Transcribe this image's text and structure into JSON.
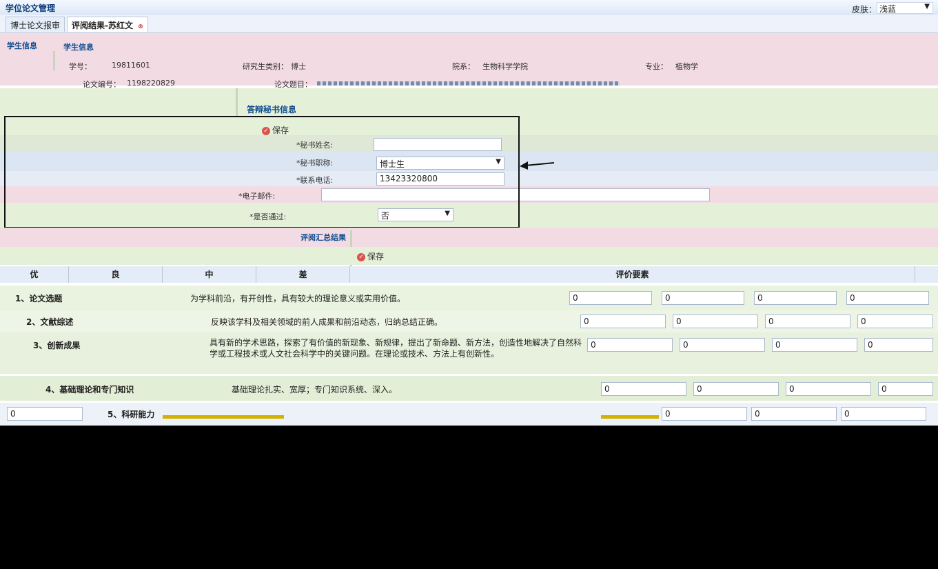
{
  "app": {
    "title": "学位论文管理"
  },
  "skin": {
    "label": "皮肤：",
    "value": "浅蓝"
  },
  "tabs": [
    {
      "label": "博士论文报审"
    },
    {
      "label": "评阅结果-苏红文"
    }
  ],
  "student": {
    "section_title": "学生信息",
    "id_label": "学号：",
    "id_value": "19811601",
    "level_label": "研究生类别：",
    "level_value": "博士",
    "dept_label": "院系：",
    "dept_value": "生物科学学院",
    "major_label": "专业：",
    "major_value": "植物学",
    "paper_id_label": "论文编号：",
    "paper_id_value": "1198220829",
    "paper_title_label": "论文题目："
  },
  "secretary": {
    "section_title": "答辩秘书信息",
    "save_label": "保存",
    "name_label": "*秘书姓名:",
    "title_label": "*秘书职称:",
    "title_value": "博士生",
    "phone_label": "*联系电话:",
    "phone_value": "13423320800",
    "email_label": "*电子邮件:",
    "pass_label": "*是否通过:",
    "pass_value": "否"
  },
  "summary": {
    "section_title": "评阅汇总结果",
    "save_label": "保存"
  },
  "table": {
    "headers": [
      "优",
      "良",
      "中",
      "差",
      "评价要素"
    ],
    "rows": [
      {
        "name": "1、论文选题",
        "desc": "为学科前沿，有开创性，具有较大的理论意义或实用价值。",
        "scores": [
          "0",
          "0",
          "0",
          "0"
        ]
      },
      {
        "name": "2、文献综述",
        "desc": "反映该学科及相关领域的前人成果和前沿动态，归纳总结正确。",
        "scores": [
          "0",
          "0",
          "0",
          "0"
        ]
      },
      {
        "name": "3、创新成果",
        "desc": "具有新的学术思路，探索了有价值的新现象、新规律，提出了新命题、新方法，创造性地解决了自然科学或工程技术或人文社会科学中的关键问题。在理论或技术、方法上有创新性。",
        "scores": [
          "0",
          "0",
          "0",
          "0"
        ]
      },
      {
        "name": "4、基础理论和专门知识",
        "desc": "基础理论扎实、宽厚；专门知识系统、深入。",
        "scores": [
          "0",
          "0",
          "0",
          "0"
        ]
      },
      {
        "name": "5、科研能力",
        "desc": "",
        "scores": [
          "0",
          "0",
          "0",
          "0"
        ]
      }
    ]
  },
  "colors": {
    "accent": "#0e4d8f",
    "pink_band": "#f3dbe4",
    "green_band": "#e5f0d9",
    "highlight": "#d4b000"
  }
}
